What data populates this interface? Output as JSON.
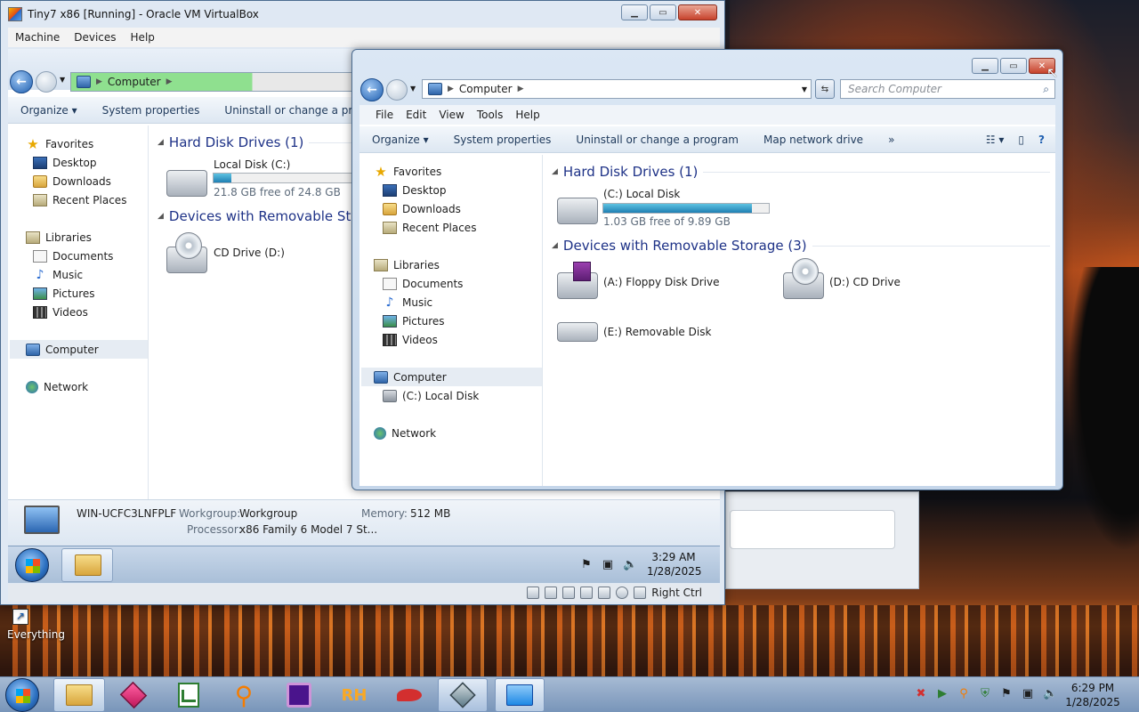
{
  "vbox": {
    "title": "Tiny7 x86 [Running] - Oracle VM VirtualBox",
    "menu": [
      "Machine",
      "Devices",
      "Help"
    ],
    "address": "Computer",
    "cmd": [
      "Organize ▾",
      "System properties",
      "Uninstall or change a program"
    ],
    "nav": {
      "favorites": "Favorites",
      "desktop": "Desktop",
      "downloads": "Downloads",
      "recent": "Recent Places",
      "libraries": "Libraries",
      "documents": "Documents",
      "music": "Music",
      "pictures": "Pictures",
      "videos": "Videos",
      "computer": "Computer",
      "network": "Network"
    },
    "hdd_section": "Hard Disk Drives (1)",
    "local_disk": "Local Disk (C:)",
    "local_disk_free": "21.8 GB free of 24.8 GB",
    "local_disk_used_fraction": 0.12,
    "removable_section": "Devices with Removable Storag",
    "cd_drive": "CD Drive (D:)",
    "details": {
      "computer_name": "WIN-UCFC3LNFPLF",
      "workgroup_label": "Workgroup:",
      "workgroup": "Workgroup",
      "memory_label": "Memory:",
      "memory": "512 MB",
      "processor_label": "Processor:",
      "processor": "x86 Family 6 Model 7 St..."
    },
    "guest_clock_time": "3:29 AM",
    "guest_clock_date": "1/28/2025",
    "host_key": "Right Ctrl"
  },
  "explorer": {
    "address": "Computer",
    "search_placeholder": "Search Computer",
    "menu": [
      "File",
      "Edit",
      "View",
      "Tools",
      "Help"
    ],
    "cmd": [
      "Organize ▾",
      "System properties",
      "Uninstall or change a program",
      "Map network drive",
      "»"
    ],
    "nav": {
      "favorites": "Favorites",
      "desktop": "Desktop",
      "downloads": "Downloads",
      "recent": "Recent Places",
      "libraries": "Libraries",
      "documents": "Documents",
      "music": "Music",
      "pictures": "Pictures",
      "videos": "Videos",
      "computer": "Computer",
      "local_disk": "(C:) Local Disk",
      "network": "Network"
    },
    "hdd_section": "Hard Disk Drives (1)",
    "local_disk": "(C:) Local Disk",
    "local_disk_free": "1.03 GB free of 9.89 GB",
    "local_disk_used_fraction": 0.9,
    "removable_section": "Devices with Removable Storage (3)",
    "floppy": "(A:) Floppy Disk Drive",
    "cd": "(D:) CD Drive",
    "removable": "(E:) Removable Disk"
  },
  "desktop": {
    "icon_label": "Everything"
  },
  "host_taskbar": {
    "clock_time": "6:29 PM",
    "clock_date": "1/28/2025",
    "apps": [
      "explorer-icon",
      "cube-app-icon",
      "text-editor-icon",
      "search-app-icon",
      "chip-app-icon",
      "rh-app-icon",
      "pepper-app-icon",
      "virtualbox-icon",
      "network-app-icon"
    ],
    "rh_text": "RH"
  },
  "colors": {
    "accent": "#1e3287",
    "link": "#1e395b",
    "bar_fill": "#1f7fb3"
  }
}
